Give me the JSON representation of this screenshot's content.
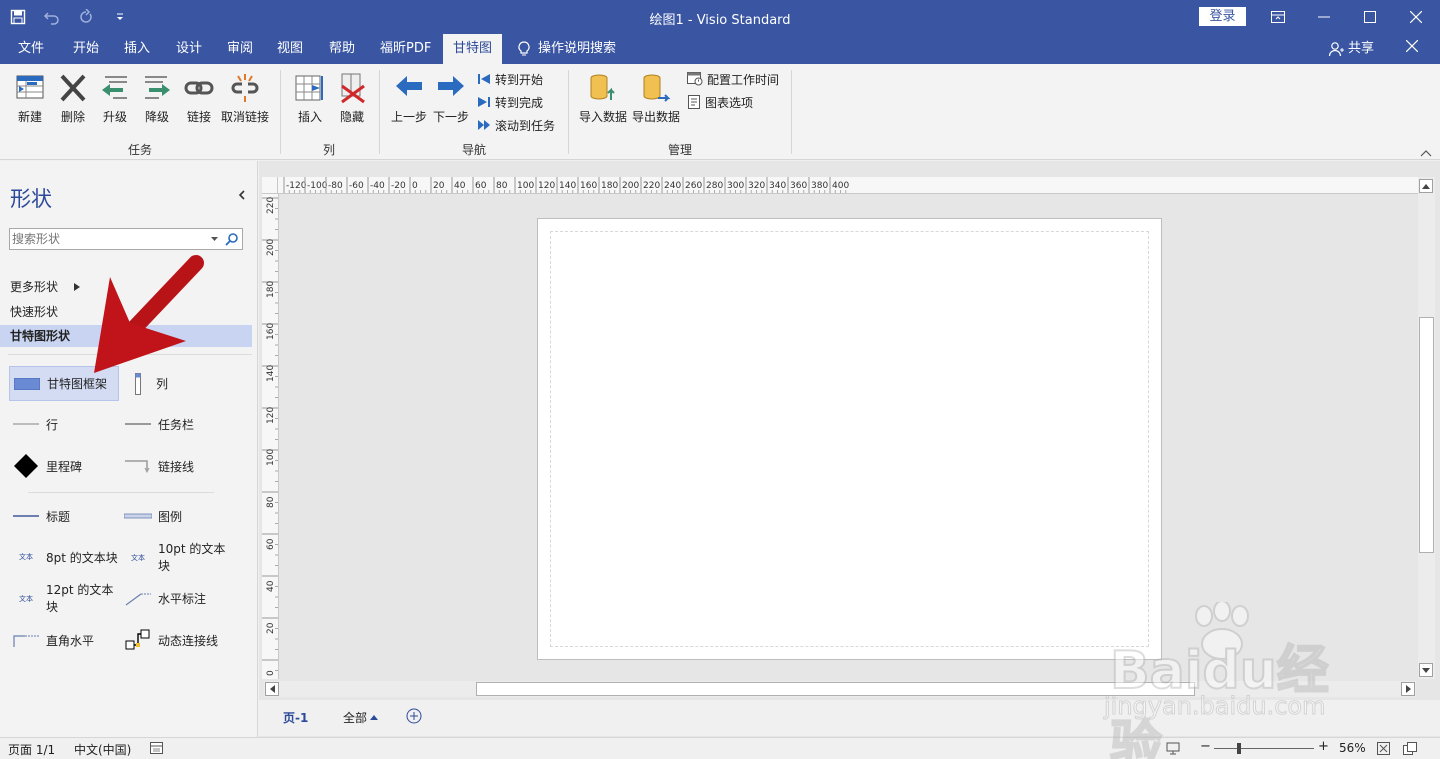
{
  "window": {
    "title": "绘图1 - Visio Standard",
    "login": "登录"
  },
  "tabs": [
    "文件",
    "开始",
    "插入",
    "设计",
    "审阅",
    "视图",
    "帮助",
    "福昕PDF",
    "甘特图"
  ],
  "tell_me": "操作说明搜索",
  "share": "共享",
  "ribbon": {
    "groups": {
      "tasks": "任务",
      "columns": "列",
      "navigation": "导航",
      "manage": "管理"
    },
    "tasks": [
      "新建",
      "删除",
      "升级",
      "降级",
      "链接",
      "取消链接"
    ],
    "columns": [
      "插入",
      "隐藏"
    ],
    "nav_big": [
      "上一步",
      "下一步"
    ],
    "nav_small": [
      "转到开始",
      "转到完成",
      "滚动到任务"
    ],
    "manage_big": [
      "导入数据",
      "导出数据"
    ],
    "manage_small": [
      "配置工作时间",
      "图表选项"
    ]
  },
  "shapes_pane": {
    "title": "形状",
    "search_placeholder": "搜索形状",
    "nav": [
      "更多形状",
      "快速形状",
      "甘特图形状"
    ],
    "items": [
      "甘特图框架",
      "列",
      "行",
      "任务栏",
      "里程碑",
      "链接线",
      "标题",
      "图例",
      "8pt 的文本块",
      "10pt 的文本块",
      "12pt 的文本块",
      "水平标注",
      "直角水平",
      "动态连接线"
    ],
    "tiny_label": "文本"
  },
  "ruler": {
    "h": [
      "-120",
      "-100",
      "-80",
      "-60",
      "-40",
      "-20",
      "0",
      "20",
      "40",
      "60",
      "80",
      "100",
      "120",
      "140",
      "160",
      "180",
      "200",
      "220",
      "240",
      "260",
      "280",
      "300",
      "320",
      "340",
      "360",
      "380",
      "400"
    ],
    "v": [
      "220",
      "200",
      "180",
      "160",
      "140",
      "120",
      "100",
      "80",
      "60",
      "40",
      "20",
      "0"
    ]
  },
  "page_tabs": {
    "page": "页-1",
    "all": "全部"
  },
  "status": {
    "page": "页面 1/1",
    "lang": "中文(中国)",
    "zoom": "56%"
  },
  "watermark": {
    "brand": "Baidu经验",
    "url": "jingyan.baidu.com"
  },
  "colors": {
    "titlebar": "#3a56a3",
    "accent_blue": "#2b4a99",
    "arrow_red": "#c0141a"
  }
}
